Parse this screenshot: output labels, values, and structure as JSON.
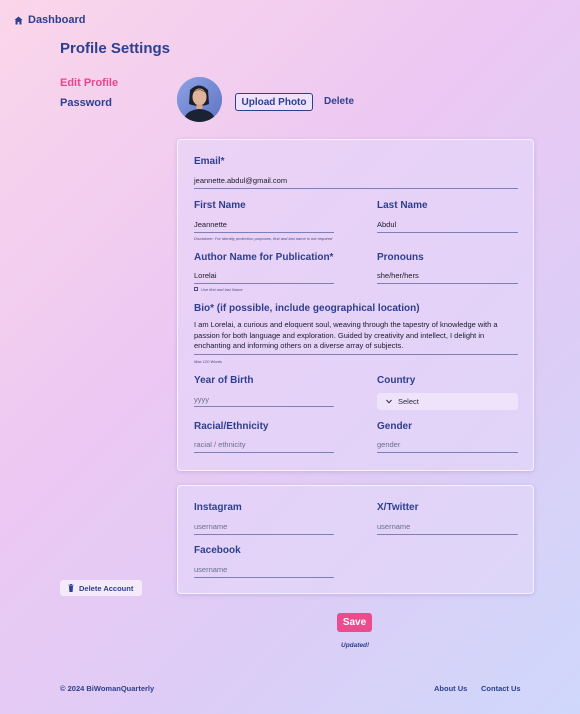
{
  "nav": {
    "dashboard": "Dashboard"
  },
  "page_title": "Profile Settings",
  "sidebar": {
    "edit_profile": "Edit Profile",
    "password": "Password",
    "delete_account": "Delete Account"
  },
  "photo": {
    "upload": "Upload Photo",
    "delete": "Delete"
  },
  "form": {
    "email": {
      "label": "Email*",
      "value": "jeannette.abdul@gmail.com"
    },
    "first_name": {
      "label": "First Name",
      "value": "Jeannette",
      "note": "Disclaimer: For identity protection purposes, first and last name is not required"
    },
    "last_name": {
      "label": "Last Name",
      "value": "Abdul"
    },
    "author_name": {
      "label": "Author Name for Publication*",
      "value": "Lorelai",
      "checkbox_label": "Use first and last Name"
    },
    "pronouns": {
      "label": "Pronouns",
      "value": "she/her/hers"
    },
    "bio": {
      "label": "Bio* (if possible, include geographical location)",
      "value": "I am Lorelai, a curious and eloquent soul, weaving through the tapestry of knowledge with a passion for both language and exploration. Guided by creativity and intellect, I delight in enchanting and informing others on a diverse array of subjects.",
      "note": "Max 120 Words"
    },
    "year_of_birth": {
      "label": "Year of Birth",
      "placeholder": "yyyy"
    },
    "country": {
      "label": "Country",
      "selected": "Select"
    },
    "race": {
      "label": "Racial/Ethnicity",
      "placeholder": "racial / ethnicity"
    },
    "gender": {
      "label": "Gender",
      "placeholder": "gender"
    }
  },
  "social": {
    "instagram": {
      "label": "Instagram",
      "placeholder": "username"
    },
    "twitter": {
      "label": "X/Twitter",
      "placeholder": "username"
    },
    "facebook": {
      "label": "Facebook",
      "placeholder": "username"
    }
  },
  "actions": {
    "save": "Save",
    "status": "Updated!"
  },
  "footer": {
    "copyright": "© 2024 BiWomanQuarterly",
    "about": "About Us",
    "contact": "Contact Us"
  },
  "colors": {
    "accent_pink": "#ec4b8e",
    "navy": "#2d3f8f"
  }
}
